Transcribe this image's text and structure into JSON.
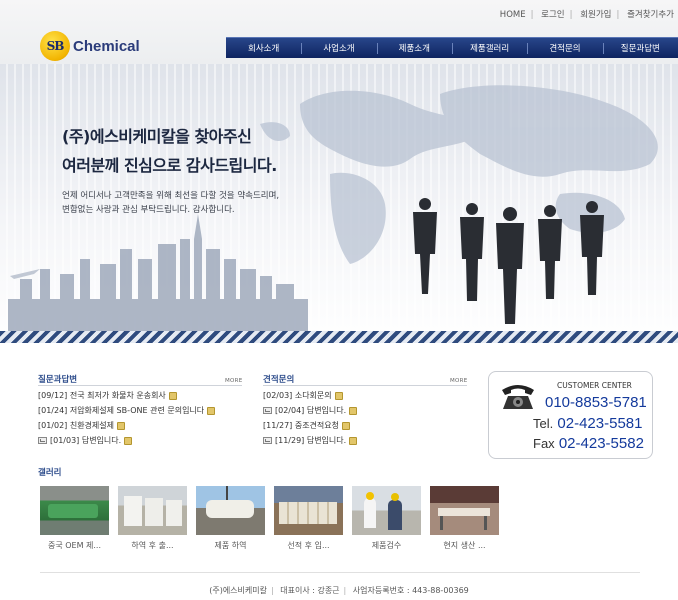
{
  "util_nav": [
    "HOME",
    "로그인",
    "회원가입",
    "즐겨찾기추가"
  ],
  "logo": {
    "badge": "SB",
    "word": "Chemical"
  },
  "gnb": [
    "회사소개",
    "사업소개",
    "제품소개",
    "제품갤러리",
    "견적문의",
    "질문과답변"
  ],
  "visual": {
    "headline_1": "(주)에스비케미칼을 찾아주신",
    "headline_2": "여러분께 진심으로 감사드립니다.",
    "sub_1": "언제 어디서나 고객만족을 위해 최선을 다할 것을 약속드리며,",
    "sub_2": "변함없는 사랑과 관심 부탁드립니다. 감사합니다."
  },
  "qna": {
    "title": "질문과답변",
    "more": "MORE",
    "items": [
      {
        "text": "[09/12] 전국 최저가 화물차 운송회사",
        "reply": false
      },
      {
        "text": "[01/24] 저압화제설제 SB-ONE 관련 문의입니다",
        "reply": false
      },
      {
        "text": "[01/02] 친환경제설제",
        "reply": false
      },
      {
        "text": "[01/03] 답변입니다.",
        "reply": true
      }
    ]
  },
  "estimate": {
    "title": "견적문의",
    "more": "MORE",
    "items": [
      {
        "text": "[02/03] 소다회문의",
        "reply": false
      },
      {
        "text": "[02/04] 답변입니다.",
        "reply": true
      },
      {
        "text": "[11/27] 중조견적요청",
        "reply": false
      },
      {
        "text": "[11/29] 답변입니다.",
        "reply": true
      }
    ]
  },
  "customer_center": {
    "title": "CUSTOMER CENTER",
    "mobile": "010-8853-5781",
    "tel_label": "Tel.",
    "tel": "02-423-5581",
    "fax_label": "Fax",
    "fax": "02-423-5582"
  },
  "gallery": {
    "title": "갤러리",
    "items": [
      {
        "caption": "중국 OEM 제...",
        "icon": "green-bags-photo"
      },
      {
        "caption": "하역 후 출...",
        "icon": "white-bags-photo"
      },
      {
        "caption": "제품 하역",
        "icon": "crane-unloading-photo"
      },
      {
        "caption": "선적 후 입...",
        "icon": "ship-loading-photo"
      },
      {
        "caption": "제품검수",
        "icon": "inspection-photo"
      },
      {
        "caption": "현지 생산 ...",
        "icon": "factory-photo"
      }
    ]
  },
  "footer": {
    "company": "(주)에스비케미칼",
    "ceo": "대표이사 : 강종근",
    "bizno": "사업자등록번호 : 443-88-00369"
  },
  "colors": {
    "nav_blue": "#0e2460",
    "accent_blue": "#143a9c",
    "title_blue": "#2e4d8c"
  }
}
